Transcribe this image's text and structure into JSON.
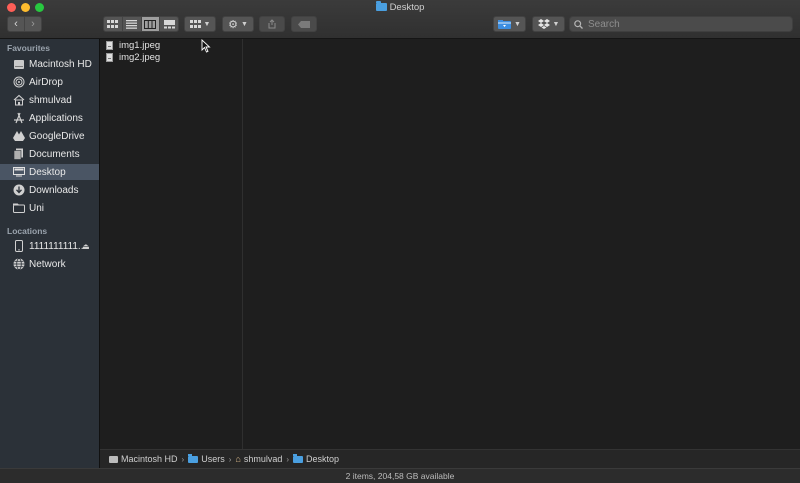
{
  "window": {
    "title": "Desktop"
  },
  "toolbar": {
    "back": "‹",
    "forward": "›",
    "search_placeholder": "Search"
  },
  "sidebar": {
    "favourites_heading": "Favourites",
    "favourites": [
      {
        "label": "Macintosh HD",
        "icon": "hard-drive-icon"
      },
      {
        "label": "AirDrop",
        "icon": "airdrop-icon"
      },
      {
        "label": "shmulvad",
        "icon": "home-icon"
      },
      {
        "label": "Applications",
        "icon": "applications-icon"
      },
      {
        "label": "GoogleDrive",
        "icon": "google-drive-icon"
      },
      {
        "label": "Documents",
        "icon": "documents-icon"
      },
      {
        "label": "Desktop",
        "icon": "desktop-icon",
        "selected": true
      },
      {
        "label": "Downloads",
        "icon": "downloads-icon"
      },
      {
        "label": "Uni",
        "icon": "folder-icon"
      }
    ],
    "locations_heading": "Locations",
    "locations": [
      {
        "label": "1111111111...",
        "icon": "phone-icon",
        "ejectable": true
      },
      {
        "label": "Network",
        "icon": "network-icon"
      }
    ]
  },
  "files": [
    {
      "name": "img1.jpeg"
    },
    {
      "name": "img2.jpeg"
    }
  ],
  "pathbar": [
    "Macintosh HD",
    "Users",
    "shmulvad",
    "Desktop"
  ],
  "status": "2 items, 204,58 GB available",
  "colors": {
    "selection": "#4a5564",
    "folder": "#4a9fe0",
    "sidebar": "#2b3138"
  }
}
